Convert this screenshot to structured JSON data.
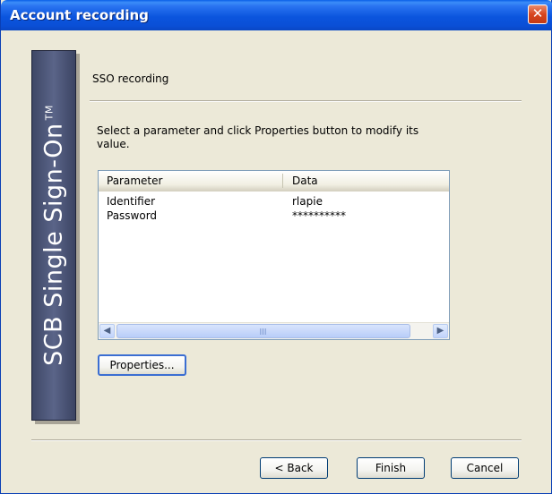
{
  "window": {
    "title": "Account recording",
    "close_glyph": "✕"
  },
  "banner": {
    "text": "SCB Single Sign-On",
    "trademark": "TM"
  },
  "page": {
    "section_label": "SSO recording",
    "instructions": "Select a parameter and click Properties button to modify its value."
  },
  "list": {
    "columns": [
      "Parameter",
      "Data"
    ],
    "rows": [
      {
        "parameter": "Identifier",
        "data": "rlapie"
      },
      {
        "parameter": "Password",
        "data": "**********"
      }
    ],
    "scroll_left_glyph": "◀",
    "scroll_right_glyph": "▶"
  },
  "buttons": {
    "properties": "Properties...",
    "back": "< Back",
    "finish": "Finish",
    "cancel": "Cancel"
  }
}
